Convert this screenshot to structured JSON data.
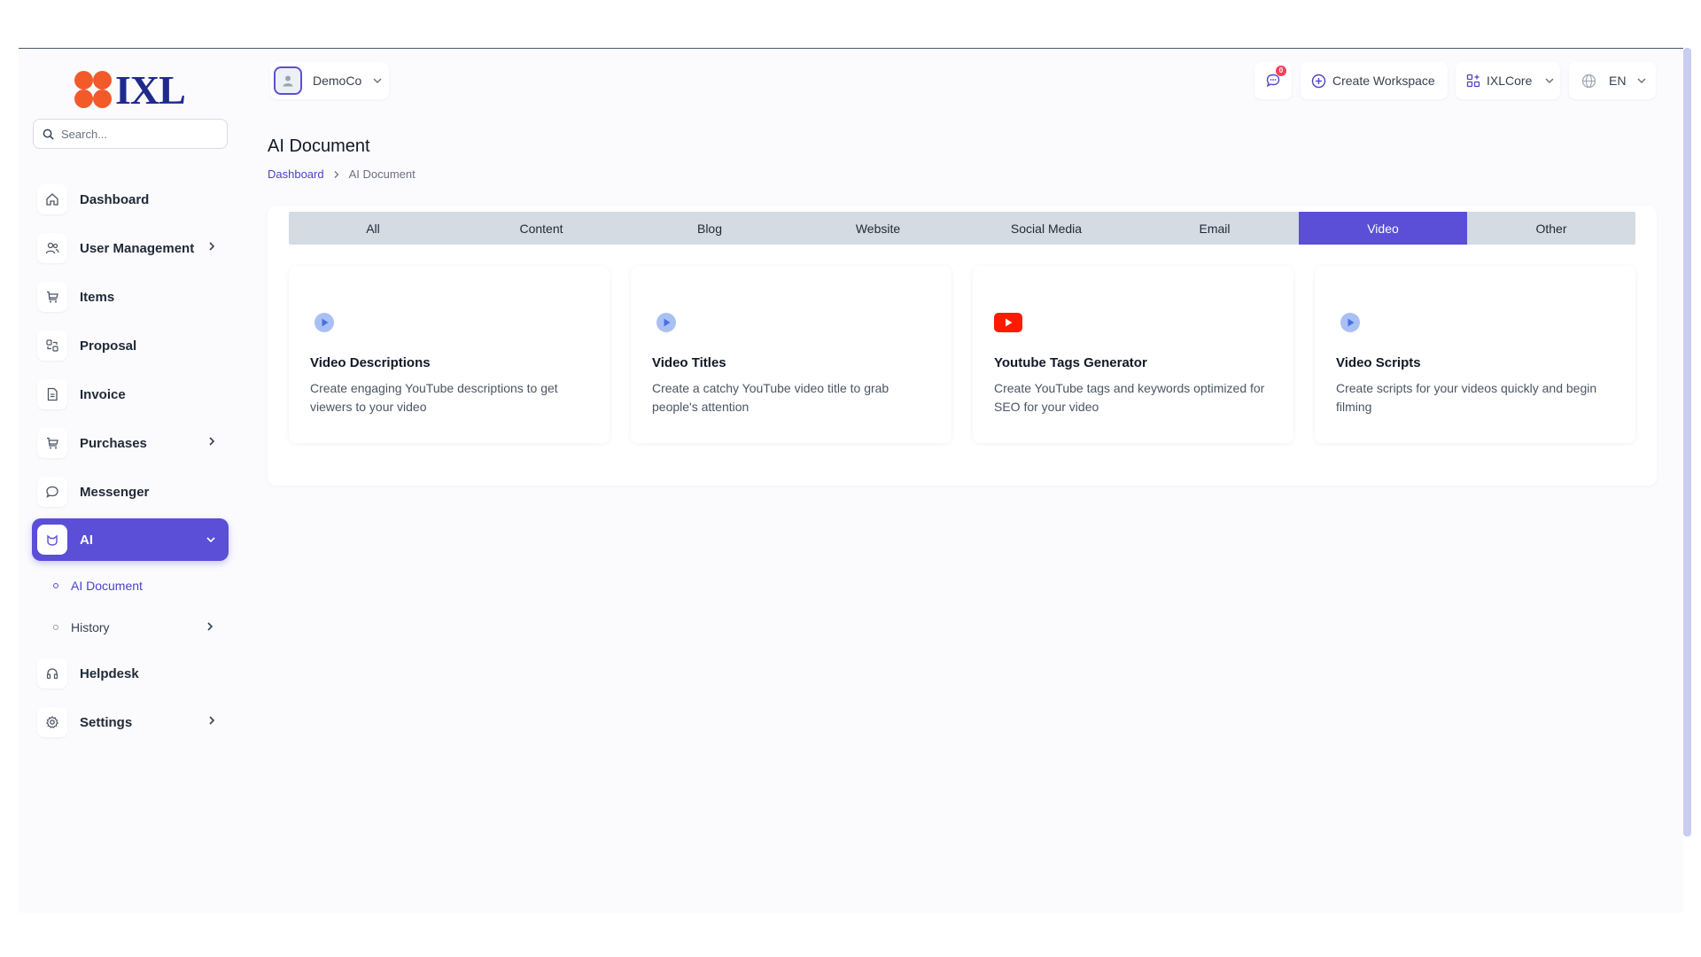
{
  "brand": {
    "name": "IXL"
  },
  "search": {
    "placeholder": "Search..."
  },
  "sidebar": {
    "items": [
      {
        "label": "Dashboard",
        "icon": "home-icon"
      },
      {
        "label": "User Management",
        "icon": "users-icon"
      },
      {
        "label": "Items",
        "icon": "cart-icon"
      },
      {
        "label": "Proposal",
        "icon": "proposal-icon"
      },
      {
        "label": "Invoice",
        "icon": "invoice-icon"
      },
      {
        "label": "Purchases",
        "icon": "cart-icon"
      },
      {
        "label": "Messenger",
        "icon": "chat-icon"
      },
      {
        "label": "AI",
        "icon": "ai-icon"
      },
      {
        "label": "Helpdesk",
        "icon": "headset-icon"
      },
      {
        "label": "Settings",
        "icon": "gear-icon"
      }
    ],
    "ai_sub": [
      {
        "label": "AI Document"
      },
      {
        "label": "History"
      }
    ],
    "active": "AI"
  },
  "header": {
    "company": "DemoCo",
    "notifications_count": "0",
    "create_workspace": "Create Workspace",
    "workspace": "IXLCore",
    "language": "EN"
  },
  "page": {
    "title": "AI Document",
    "breadcrumb": {
      "home": "Dashboard",
      "current": "AI Document"
    }
  },
  "tabs": [
    "All",
    "Content",
    "Blog",
    "Website",
    "Social Media",
    "Email",
    "Video",
    "Other"
  ],
  "active_tab": "Video",
  "cards": [
    {
      "title": "Video Descriptions",
      "desc": "Create engaging YouTube descriptions to get viewers to your video",
      "icon": "play-circle-icon"
    },
    {
      "title": "Video Titles",
      "desc": "Create a catchy YouTube video title to grab people's attention",
      "icon": "play-circle-icon"
    },
    {
      "title": "Youtube Tags Generator",
      "desc": "Create YouTube tags and keywords optimized for SEO for your video",
      "icon": "youtube-icon"
    },
    {
      "title": "Video Scripts",
      "desc": "Create scripts for your videos quickly and begin filming",
      "icon": "play-circle-icon"
    }
  ],
  "colors": {
    "accent": "#5a4fd6",
    "youtube": "#ff0000",
    "tabs_bg": "#d4dbe3"
  }
}
